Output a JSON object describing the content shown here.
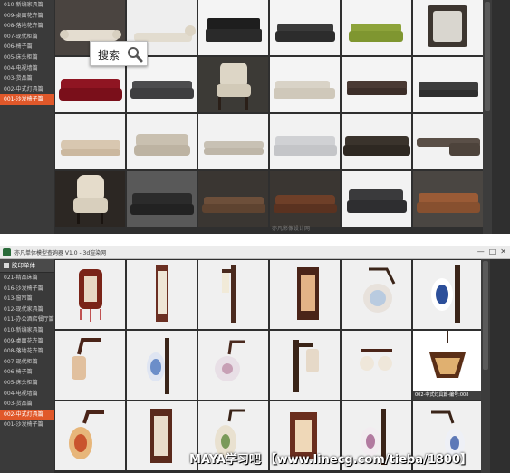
{
  "top_panel": {
    "sidebar_items": [
      "010-新编家具篇",
      "009-桌面花卉篇",
      "008-落地花卉篇",
      "007-现代柜篇",
      "006-椅子篇",
      "005-床头柜篇",
      "004-电视墙篇",
      "003-货品篇",
      "002-中式灯具篇",
      "001-沙发椅子篇"
    ],
    "active_index": 9,
    "search_label": "搜索",
    "image_watermark": "亦凡影像设计网"
  },
  "bottom_panel": {
    "window_title": "亦凡单体模型查询器 V1.0 - 3d渲染网",
    "window_buttons": [
      "—",
      "□",
      "✕"
    ],
    "sidebar_header": "胶印单体",
    "sidebar_items": [
      "021-精品床篇",
      "016-沙发椅子篇",
      "013-窗帘篇",
      "012-现代家具篇",
      "011-办公酒店餐厅篇",
      "010-新编家具篇",
      "009-桌面花卉篇",
      "008-落地花卉篇",
      "007-现代柜篇",
      "006-椅子篇",
      "005-床头柜篇",
      "004-电视墙篇",
      "003-货品篇",
      "002-中式灯具篇",
      "001-沙发椅子篇"
    ],
    "active_index": 13,
    "selected_caption": "002-中式灯具篇-编号:008"
  },
  "footer_watermark": {
    "brand": "MAYA学习吧",
    "url": "【www.linecg.com/tieba/1800】"
  },
  "colors": {
    "active": "#e0582a",
    "sidebar_bg": "#3a3a3a",
    "panel_bg": "#2f2f2f"
  }
}
